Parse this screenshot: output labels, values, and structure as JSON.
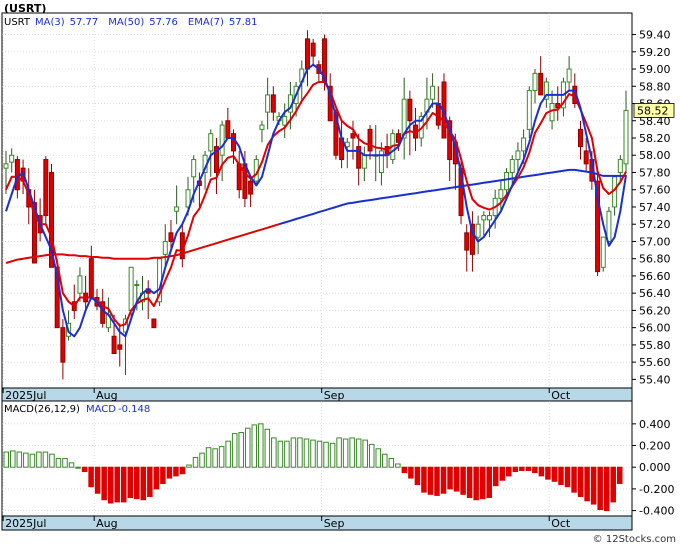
{
  "title": "(USRT)",
  "watermark": "© 12Stocks.com",
  "colors": {
    "up": "#3a8a28",
    "down": "#e00000",
    "ma_fast": "#1a2fd0",
    "ma_slow": "#e00000",
    "date_bar": "#b8d8e8",
    "grid": "#d0d0d0",
    "price_tag_bg": "#ffffaa"
  },
  "chart_data": [
    {
      "type": "candlestick",
      "symbol": "USRT",
      "legend": [
        {
          "name": "USRT",
          "color": "#000000"
        },
        {
          "name": "MA(3)",
          "value": "57.77",
          "color": "#1a2fd0"
        },
        {
          "name": "MA(50)",
          "value": "57.76",
          "color": "#1a2fd0"
        },
        {
          "name": "EMA(7)",
          "value": "57.81",
          "color": "#1a2fd0"
        }
      ],
      "last_price_label": "58.52",
      "ylim": [
        55.3,
        59.65
      ],
      "yticks": [
        "55.40",
        "55.60",
        "55.80",
        "56.00",
        "56.20",
        "56.40",
        "56.60",
        "56.80",
        "57.00",
        "57.20",
        "57.40",
        "57.60",
        "57.80",
        "58.00",
        "58.20",
        "58.40",
        "58.60",
        "58.80",
        "59.00",
        "59.20",
        "59.40"
      ],
      "x_labels": [
        {
          "text": "2025Jul",
          "index": 0
        },
        {
          "text": "Aug",
          "index": 16
        },
        {
          "text": "Sep",
          "index": 56
        },
        {
          "text": "Oct",
          "index": 96
        }
      ],
      "candles": [
        [
          57.85,
          58.05,
          57.55,
          57.9
        ],
        [
          57.92,
          58.08,
          57.8,
          58.0
        ],
        [
          57.95,
          57.99,
          57.5,
          57.6
        ],
        [
          57.85,
          57.95,
          57.55,
          57.7
        ],
        [
          57.6,
          57.85,
          57.2,
          57.4
        ],
        [
          57.45,
          57.6,
          56.85,
          56.75
        ],
        [
          57.3,
          57.5,
          57.0,
          57.1
        ],
        [
          57.95,
          57.99,
          57.2,
          57.3
        ],
        [
          57.8,
          57.9,
          56.7,
          56.7
        ],
        [
          56.7,
          56.8,
          56.1,
          56.0
        ],
        [
          56.0,
          56.1,
          55.4,
          55.6
        ],
        [
          55.9,
          56.2,
          55.85,
          56.05
        ],
        [
          56.3,
          56.5,
          56.1,
          56.2
        ],
        [
          56.4,
          56.7,
          56.3,
          56.6
        ],
        [
          56.4,
          56.6,
          56.2,
          56.3
        ],
        [
          56.8,
          56.95,
          56.35,
          56.35
        ],
        [
          56.35,
          56.45,
          56.2,
          56.25
        ],
        [
          56.3,
          56.45,
          56.0,
          56.05
        ],
        [
          56.0,
          56.35,
          55.95,
          56.15
        ],
        [
          55.9,
          56.15,
          55.7,
          55.7
        ],
        [
          55.8,
          56.05,
          55.55,
          55.75
        ],
        [
          55.95,
          56.15,
          55.45,
          56.1
        ],
        [
          56.2,
          56.7,
          56.1,
          56.7
        ],
        [
          56.5,
          56.55,
          56.2,
          56.5
        ],
        [
          56.3,
          56.6,
          56.2,
          56.4
        ],
        [
          56.45,
          56.55,
          56.1,
          56.4
        ],
        [
          56.1,
          56.1,
          56.05,
          56.0
        ],
        [
          56.3,
          56.8,
          56.25,
          56.8
        ],
        [
          56.85,
          57.2,
          56.7,
          57.0
        ],
        [
          57.1,
          57.25,
          56.9,
          57.0
        ],
        [
          57.35,
          57.65,
          57.2,
          57.4
        ],
        [
          57.1,
          57.2,
          56.7,
          56.8
        ],
        [
          57.4,
          57.75,
          57.3,
          57.6
        ],
        [
          57.75,
          58.0,
          57.45,
          57.95
        ],
        [
          57.7,
          57.8,
          57.4,
          57.65
        ],
        [
          57.8,
          58.05,
          57.6,
          58.0
        ],
        [
          58.05,
          58.3,
          57.75,
          58.25
        ],
        [
          58.1,
          58.2,
          57.55,
          57.8
        ],
        [
          58.0,
          58.4,
          57.7,
          58.35
        ],
        [
          58.4,
          58.55,
          58.2,
          58.2
        ],
        [
          58.25,
          58.3,
          57.9,
          58.05
        ],
        [
          57.9,
          58.05,
          57.5,
          57.6
        ],
        [
          57.9,
          58.05,
          57.4,
          57.5
        ],
        [
          57.7,
          57.75,
          57.4,
          57.55
        ],
        [
          57.7,
          58.0,
          57.65,
          57.95
        ],
        [
          58.3,
          58.4,
          58.15,
          58.35
        ],
        [
          58.5,
          58.9,
          58.3,
          58.7
        ],
        [
          58.7,
          58.8,
          58.4,
          58.5
        ],
        [
          58.4,
          58.5,
          58.35,
          58.45
        ],
        [
          58.35,
          58.6,
          58.2,
          58.45
        ],
        [
          58.5,
          58.85,
          58.3,
          58.7
        ],
        [
          58.6,
          58.85,
          58.45,
          58.8
        ],
        [
          58.85,
          59.1,
          58.6,
          59.0
        ],
        [
          59.35,
          59.45,
          58.8,
          59.0
        ],
        [
          59.3,
          59.35,
          59.05,
          59.15
        ],
        [
          59.05,
          59.1,
          58.85,
          58.95
        ],
        [
          59.35,
          59.4,
          58.75,
          58.85
        ],
        [
          58.8,
          58.95,
          58.4,
          58.4
        ],
        [
          58.5,
          58.55,
          57.95,
          58.0
        ],
        [
          58.2,
          58.4,
          57.85,
          57.95
        ],
        [
          58.1,
          58.2,
          57.85,
          58.15
        ],
        [
          58.25,
          58.4,
          57.95,
          58.2
        ],
        [
          58.1,
          58.25,
          57.65,
          57.85
        ],
        [
          57.85,
          58.1,
          57.7,
          58.0
        ],
        [
          58.3,
          58.35,
          57.95,
          58.05
        ],
        [
          58.0,
          58.35,
          57.7,
          58.0
        ],
        [
          57.8,
          58.15,
          57.65,
          58.05
        ],
        [
          58.1,
          58.25,
          57.85,
          58.0
        ],
        [
          57.95,
          58.3,
          57.9,
          58.25
        ],
        [
          58.25,
          58.3,
          58.05,
          58.15
        ],
        [
          58.2,
          58.9,
          57.95,
          58.65
        ],
        [
          58.65,
          58.75,
          58.0,
          58.4
        ],
        [
          58.35,
          58.55,
          58.05,
          58.2
        ],
        [
          58.2,
          58.5,
          58.1,
          58.45
        ],
        [
          58.5,
          58.9,
          58.3,
          58.65
        ],
        [
          58.65,
          58.95,
          58.55,
          58.8
        ],
        [
          58.6,
          58.8,
          58.3,
          58.35
        ],
        [
          58.85,
          58.95,
          58.2,
          58.2
        ],
        [
          58.4,
          58.45,
          57.7,
          57.95
        ],
        [
          58.15,
          58.25,
          57.6,
          57.9
        ],
        [
          57.85,
          57.95,
          57.2,
          57.3
        ],
        [
          57.1,
          57.2,
          56.65,
          56.9
        ],
        [
          57.2,
          57.35,
          56.65,
          56.85
        ],
        [
          57.05,
          57.3,
          56.85,
          57.2
        ],
        [
          57.25,
          57.35,
          57.05,
          57.3
        ],
        [
          57.25,
          57.35,
          57.05,
          57.3
        ],
        [
          57.3,
          57.6,
          57.15,
          57.5
        ],
        [
          57.5,
          57.7,
          57.35,
          57.6
        ],
        [
          57.6,
          57.85,
          57.5,
          57.8
        ],
        [
          57.8,
          58.0,
          57.65,
          57.95
        ],
        [
          57.95,
          58.15,
          57.8,
          58.05
        ],
        [
          58.05,
          58.3,
          57.9,
          58.2
        ],
        [
          58.3,
          58.8,
          58.2,
          58.75
        ],
        [
          58.75,
          59.0,
          58.6,
          58.95
        ],
        [
          58.95,
          59.15,
          58.8,
          58.7
        ],
        [
          58.65,
          58.9,
          58.55,
          58.85
        ],
        [
          58.4,
          58.75,
          58.3,
          58.6
        ],
        [
          58.6,
          58.8,
          58.4,
          58.55
        ],
        [
          58.55,
          58.9,
          58.45,
          58.85
        ],
        [
          58.85,
          59.15,
          58.75,
          59.0
        ],
        [
          58.8,
          58.95,
          58.55,
          58.6
        ],
        [
          58.3,
          58.4,
          57.95,
          58.1
        ],
        [
          58.05,
          58.2,
          57.8,
          57.9
        ],
        [
          57.95,
          58.05,
          57.6,
          57.7
        ],
        [
          57.7,
          57.85,
          56.6,
          56.65
        ],
        [
          56.7,
          57.05,
          56.65,
          57.05
        ],
        [
          57.0,
          57.4,
          56.95,
          57.35
        ],
        [
          57.4,
          57.7,
          57.3,
          57.75
        ],
        [
          57.8,
          58.0,
          57.7,
          57.95
        ],
        [
          57.9,
          58.75,
          57.8,
          58.52
        ]
      ],
      "ma_fast": [
        57.35,
        57.55,
        57.75,
        57.8,
        57.6,
        57.4,
        57.2,
        57.05,
        56.9,
        56.6,
        56.2,
        55.95,
        55.9,
        56.0,
        56.2,
        56.35,
        56.3,
        56.2,
        56.15,
        56.05,
        55.95,
        55.9,
        56.1,
        56.3,
        56.4,
        56.45,
        56.4,
        56.45,
        56.7,
        56.9,
        57.1,
        57.2,
        57.35,
        57.55,
        57.7,
        57.85,
        58.0,
        58.05,
        58.1,
        58.2,
        58.2,
        58.1,
        57.9,
        57.75,
        57.65,
        57.75,
        58.0,
        58.25,
        58.4,
        58.5,
        58.55,
        58.7,
        58.85,
        59.0,
        59.05,
        59.0,
        58.9,
        58.7,
        58.45,
        58.2,
        58.05,
        58.05,
        58.05,
        58.0,
        58.0,
        58.0,
        58.0,
        58.0,
        58.05,
        58.1,
        58.25,
        58.35,
        58.4,
        58.4,
        58.5,
        58.6,
        58.6,
        58.5,
        58.3,
        58.1,
        57.8,
        57.4,
        57.1,
        57.0,
        57.05,
        57.15,
        57.25,
        57.35,
        57.5,
        57.65,
        57.8,
        57.95,
        58.15,
        58.4,
        58.6,
        58.7,
        58.7,
        58.7,
        58.7,
        58.75,
        58.75,
        58.55,
        58.25,
        57.95,
        57.5,
        57.2,
        56.95,
        57.05,
        57.35,
        57.77
      ],
      "ma_slow": [
        56.75,
        56.77,
        56.79,
        56.8,
        56.81,
        56.82,
        56.83,
        56.84,
        56.85,
        56.85,
        56.85,
        56.84,
        56.84,
        56.83,
        56.83,
        56.82,
        56.82,
        56.81,
        56.81,
        56.8,
        56.8,
        56.8,
        56.8,
        56.8,
        56.8,
        56.8,
        56.81,
        56.81,
        56.82,
        56.83,
        56.84,
        56.86,
        56.88,
        56.9,
        56.92,
        56.94,
        56.96,
        56.98,
        57.0,
        57.02,
        57.04,
        57.06,
        57.08,
        57.1,
        57.12,
        57.14,
        57.16,
        57.18,
        57.2,
        57.22,
        57.24,
        57.26,
        57.28,
        57.3,
        57.32,
        57.34,
        57.36,
        57.38,
        57.4,
        57.42,
        57.44,
        57.45,
        57.46,
        57.47,
        57.48,
        57.49,
        57.5,
        57.51,
        57.52,
        57.53,
        57.54,
        57.55,
        57.56,
        57.57,
        57.58,
        57.59,
        57.6,
        57.61,
        57.62,
        57.63,
        57.64,
        57.65,
        57.66,
        57.67,
        57.68,
        57.69,
        57.7,
        57.71,
        57.72,
        57.73,
        57.74,
        57.75,
        57.76,
        57.77,
        57.78,
        57.79,
        57.8,
        57.81,
        57.82,
        57.83,
        57.83,
        57.82,
        57.81,
        57.8,
        57.78,
        57.76,
        57.76,
        57.76,
        57.76,
        57.76
      ],
      "ema": [
        57.6,
        57.75,
        57.75,
        57.7,
        57.55,
        57.3,
        57.2,
        57.2,
        57.05,
        56.75,
        56.4,
        56.3,
        56.25,
        56.35,
        56.35,
        56.35,
        56.32,
        56.25,
        56.22,
        56.1,
        56.02,
        56.04,
        56.2,
        56.28,
        56.32,
        56.34,
        56.25,
        56.39,
        56.55,
        56.7,
        56.9,
        56.89,
        57.07,
        57.29,
        57.38,
        57.54,
        57.72,
        57.74,
        57.89,
        57.97,
        57.99,
        57.89,
        57.79,
        57.73,
        57.78,
        57.92,
        58.12,
        58.22,
        58.28,
        58.32,
        58.41,
        58.51,
        58.63,
        58.72,
        58.82,
        58.85,
        58.85,
        58.74,
        58.56,
        58.4,
        58.34,
        58.3,
        58.19,
        58.14,
        58.12,
        58.09,
        58.08,
        58.06,
        58.11,
        58.12,
        58.25,
        58.28,
        58.26,
        58.31,
        58.39,
        58.49,
        58.45,
        58.39,
        58.28,
        58.18,
        57.96,
        57.7,
        57.49,
        57.42,
        57.39,
        57.37,
        57.4,
        57.45,
        57.54,
        57.64,
        57.74,
        57.86,
        58.03,
        58.26,
        58.37,
        58.49,
        58.52,
        58.53,
        58.61,
        58.71,
        58.68,
        58.53,
        58.37,
        58.2,
        57.81,
        57.62,
        57.55,
        57.6,
        57.69,
        57.81
      ],
      "last_value": 58.52
    },
    {
      "type": "bar",
      "title": "MACD(26,12,9)",
      "legend": [
        {
          "name": "MACD",
          "value": "-0.148"
        }
      ],
      "ylim": [
        -0.45,
        0.5
      ],
      "yticks": [
        "0.400",
        "0.200",
        "0.000",
        "-0.200",
        "-0.400"
      ],
      "x_labels": [
        {
          "text": "2025Jul",
          "index": 0
        },
        {
          "text": "Aug",
          "index": 16
        },
        {
          "text": "Sep",
          "index": 56
        },
        {
          "text": "Oct",
          "index": 96
        }
      ],
      "values": [
        0.14,
        0.15,
        0.14,
        0.13,
        0.12,
        0.14,
        0.14,
        0.12,
        0.08,
        0.08,
        0.04,
        0.0,
        -0.04,
        -0.18,
        -0.24,
        -0.3,
        -0.33,
        -0.32,
        -0.32,
        -0.28,
        -0.29,
        -0.3,
        -0.27,
        -0.2,
        -0.15,
        -0.1,
        -0.08,
        -0.06,
        0.02,
        0.09,
        0.13,
        0.18,
        0.17,
        0.19,
        0.24,
        0.31,
        0.32,
        0.36,
        0.39,
        0.4,
        0.35,
        0.27,
        0.24,
        0.24,
        0.27,
        0.27,
        0.26,
        0.25,
        0.24,
        0.23,
        0.22,
        0.27,
        0.26,
        0.27,
        0.26,
        0.25,
        0.21,
        0.17,
        0.12,
        0.08,
        0.03,
        -0.05,
        -0.1,
        -0.16,
        -0.23,
        -0.25,
        -0.26,
        -0.24,
        -0.2,
        -0.22,
        -0.25,
        -0.28,
        -0.3,
        -0.29,
        -0.28,
        -0.17,
        -0.12,
        -0.08,
        -0.04,
        -0.03,
        -0.03,
        -0.05,
        -0.08,
        -0.11,
        -0.13,
        -0.16,
        -0.18,
        -0.23,
        -0.27,
        -0.31,
        -0.34,
        -0.39,
        -0.4,
        -0.32,
        -0.15
      ]
    }
  ]
}
